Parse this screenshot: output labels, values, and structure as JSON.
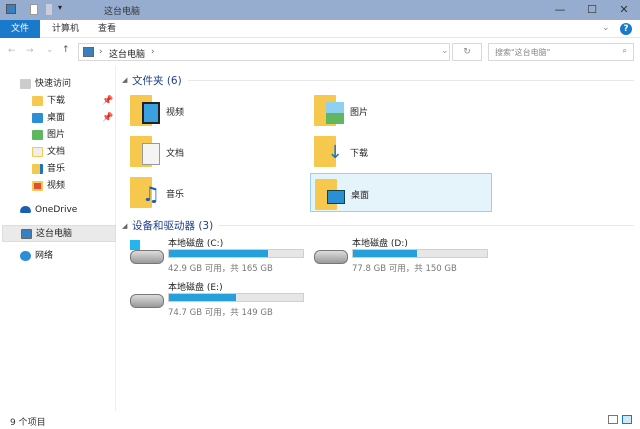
{
  "window": {
    "title": "这台电脑",
    "minimize": "—",
    "maximize": "☐",
    "close": "✕"
  },
  "ribbon": {
    "tabs": [
      "文件",
      "计算机",
      "查看"
    ],
    "help": "?",
    "expand": "⌄"
  },
  "nav": {
    "back": "←",
    "forward": "→",
    "recent": "⌄",
    "up": "↑",
    "path": "这台电脑",
    "sep": "›",
    "refresh": "↻",
    "search_placeholder": "搜索\"这台电脑\"",
    "search_icon": "⌕"
  },
  "sidebar": {
    "quick_access": "快速访问",
    "items": [
      {
        "label": "下载",
        "pinned": true,
        "color": "#f6c94e"
      },
      {
        "label": "桌面",
        "pinned": true,
        "color": "#2a8fd6"
      },
      {
        "label": "图片",
        "color": "#5fb85f"
      },
      {
        "label": "文档",
        "color": "#eee"
      },
      {
        "label": "音乐",
        "color": "#1a73c8"
      },
      {
        "label": "视频",
        "color": "#e04b3a"
      }
    ],
    "onedrive": "OneDrive",
    "this_pc": "这台电脑",
    "network": "网络"
  },
  "folders": {
    "heading": "文件夹 (6)",
    "items": [
      "视频",
      "图片",
      "文档",
      "下载",
      "音乐",
      "桌面"
    ]
  },
  "drives": {
    "heading": "设备和驱动器 (3)",
    "items": [
      {
        "name": "本地磁盘 (C:)",
        "info": "42.9 GB 可用，共 165 GB",
        "used": 0.74
      },
      {
        "name": "本地磁盘 (D:)",
        "info": "77.8 GB 可用，共 150 GB",
        "used": 0.48
      },
      {
        "name": "本地磁盘 (E:)",
        "info": "74.7 GB 可用，共 149 GB",
        "used": 0.5
      }
    ]
  },
  "status": {
    "count": "9 个项目"
  }
}
